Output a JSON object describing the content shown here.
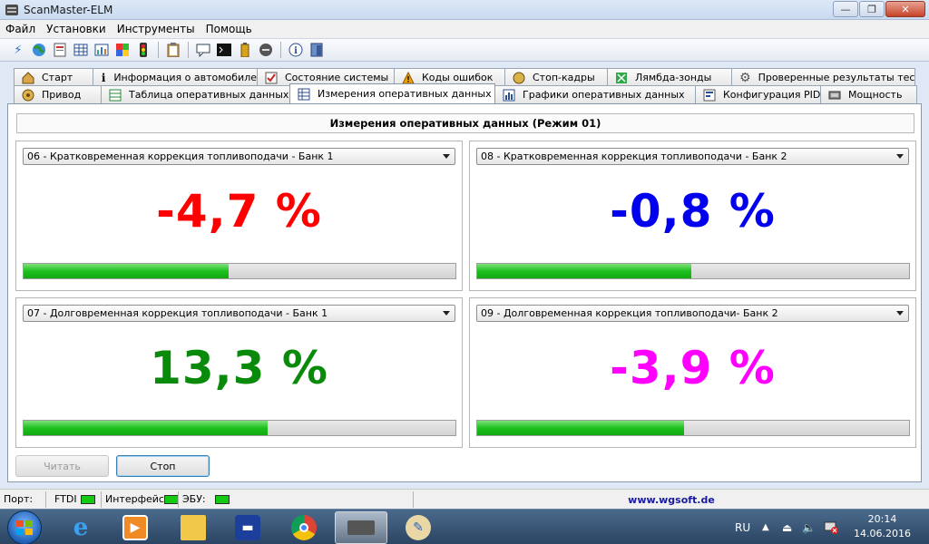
{
  "window": {
    "title": "ScanMaster-ELM",
    "buttons": {
      "minimize": "—",
      "maximize": "❐",
      "close": "✕"
    }
  },
  "menu": [
    "Файл",
    "Установки",
    "Инструменты",
    "Помощь"
  ],
  "tabs": {
    "row1": [
      {
        "label": "Старт",
        "icon": "start-icon"
      },
      {
        "label": "Информация о автомобиле",
        "icon": "info-icon"
      },
      {
        "label": "Состояние системы",
        "icon": "checklist-icon"
      },
      {
        "label": "Коды ошибок",
        "icon": "warning-icon"
      },
      {
        "label": "Стоп-кадры",
        "icon": "freeze-frame-icon"
      },
      {
        "label": "Лямбда-зонды",
        "icon": "lambda-icon"
      },
      {
        "label": "Проверенные результаты теста",
        "icon": "gear-icon"
      }
    ],
    "row2": [
      {
        "label": "Привод",
        "icon": "drive-icon"
      },
      {
        "label": "Таблица оперативных данных",
        "icon": "table-icon"
      },
      {
        "label": "Измерения оперативных данных",
        "icon": "measure-icon",
        "active": true
      },
      {
        "label": "Графики оперативных данных",
        "icon": "chart-icon"
      },
      {
        "label": "Конфигурация PID",
        "icon": "config-icon"
      },
      {
        "label": "Мощность",
        "icon": "power-icon"
      }
    ]
  },
  "panel": {
    "title": "Измерения оперативных данных (Режим 01)",
    "gauges": [
      {
        "pid": "06 - Кратковременная коррекция топливоподачи - Банк 1",
        "value": "-4,7 %",
        "color": "#ff0000",
        "fill": 0.475
      },
      {
        "pid": "08 - Кратковременная коррекция топливоподачи - Банк 2",
        "value": "-0,8 %",
        "color": "#0000ee",
        "fill": 0.495
      },
      {
        "pid": "07 - Долговременная коррекция топливоподачи - Банк 1",
        "value": "13,3 %",
        "color": "#0a8a0a",
        "fill": 0.565
      },
      {
        "pid": "09 - Долговременная коррекция топливоподачи- Банк 2",
        "value": "-3,9 %",
        "color": "#ff00ff",
        "fill": 0.48
      }
    ],
    "read_button": "Читать",
    "stop_button": "Стоп"
  },
  "statusbar": {
    "port_label": "Порт:",
    "ftdi_label": "FTDI",
    "interface_label": "Интерфейс",
    "ecu_label": "ЭБУ:",
    "url": "www.wgsoft.de",
    "led_color": "#13c913"
  },
  "taskbar": {
    "language": "RU",
    "time": "20:14",
    "date": "14.06.2016"
  }
}
